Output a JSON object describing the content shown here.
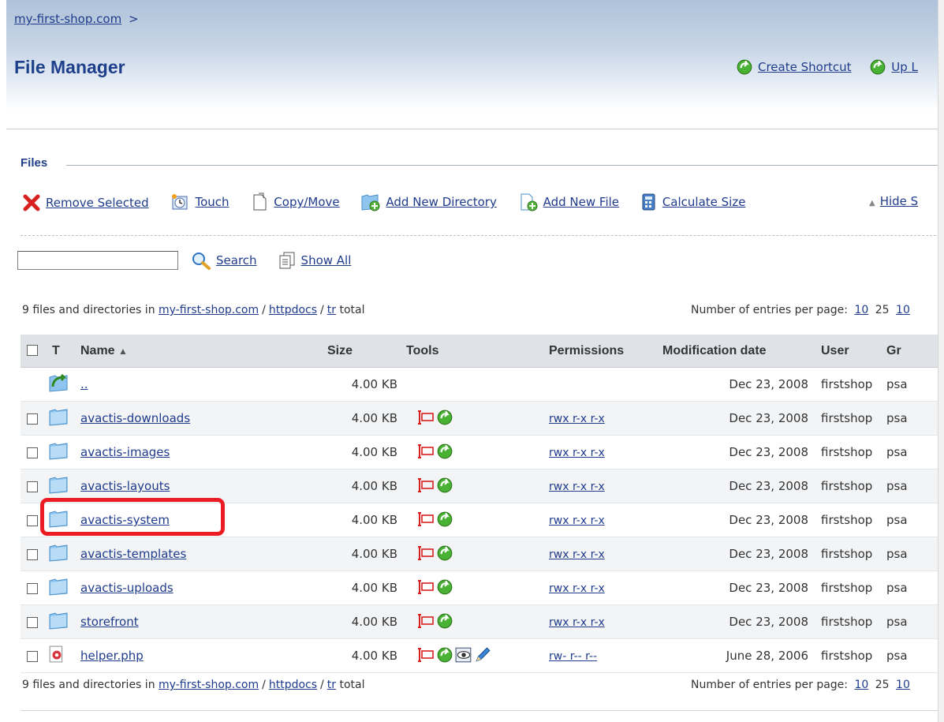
{
  "breadcrumb": {
    "link": "my-first-shop.com",
    "separator": ">"
  },
  "title": "File Manager",
  "header_actions": {
    "create_shortcut": "Create Shortcut",
    "up_level": "Up L"
  },
  "section": {
    "legend": "Files"
  },
  "toolbar": {
    "remove_selected": "Remove Selected",
    "touch": "Touch",
    "copy_move": "Copy/Move",
    "add_new_directory": "Add New Directory",
    "add_new_file": "Add New File",
    "calculate_size": "Calculate Size",
    "hide": "Hide S"
  },
  "search": {
    "value": "",
    "search_label": "Search",
    "show_all_label": "Show All"
  },
  "info": {
    "prefix": "9 files and directories in",
    "path": [
      "my-first-shop.com",
      "httpdocs",
      "tr"
    ],
    "path_sep": "/",
    "suffix": "total",
    "per_page_label": "Number of entries per page:",
    "per_page_options": [
      "10",
      "25",
      "10"
    ]
  },
  "table": {
    "headers": {
      "type": "T",
      "name": "Name",
      "sort_indicator": "▲",
      "size": "Size",
      "tools": "Tools",
      "permissions": "Permissions",
      "modified": "Modification date",
      "user": "User",
      "group": "Gr"
    },
    "rows": [
      {
        "name": "..",
        "size": "4.00 KB",
        "perms": "",
        "date": "Dec 23, 2008",
        "user": "firstshop",
        "group": "psa"
      },
      {
        "name": "avactis-downloads",
        "size": "4.00 KB",
        "perms": "rwx r-x r-x",
        "date": "Dec 23, 2008",
        "user": "firstshop",
        "group": "psa"
      },
      {
        "name": "avactis-images",
        "size": "4.00 KB",
        "perms": "rwx r-x r-x",
        "date": "Dec 23, 2008",
        "user": "firstshop",
        "group": "psa"
      },
      {
        "name": "avactis-layouts",
        "size": "4.00 KB",
        "perms": "rwx r-x r-x",
        "date": "Dec 23, 2008",
        "user": "firstshop",
        "group": "psa"
      },
      {
        "name": "avactis-system",
        "size": "4.00 KB",
        "perms": "rwx r-x r-x",
        "date": "Dec 23, 2008",
        "user": "firstshop",
        "group": "psa"
      },
      {
        "name": "avactis-templates",
        "size": "4.00 KB",
        "perms": "rwx r-x r-x",
        "date": "Dec 23, 2008",
        "user": "firstshop",
        "group": "psa"
      },
      {
        "name": "avactis-uploads",
        "size": "4.00 KB",
        "perms": "rwx r-x r-x",
        "date": "Dec 23, 2008",
        "user": "firstshop",
        "group": "psa"
      },
      {
        "name": "storefront",
        "size": "4.00 KB",
        "perms": "rwx r-x r-x",
        "date": "Dec 23, 2008",
        "user": "firstshop",
        "group": "psa"
      },
      {
        "name": "helper.php",
        "size": "4.00 KB",
        "perms": "rw- r-- r--",
        "date": "June 28, 2006",
        "user": "firstshop",
        "group": "psa"
      }
    ]
  },
  "colors": {
    "title": "#1e3f8a",
    "link": "#1f3b8c",
    "highlight": "#ec1c24",
    "header_bg": "#dfe3e8"
  }
}
